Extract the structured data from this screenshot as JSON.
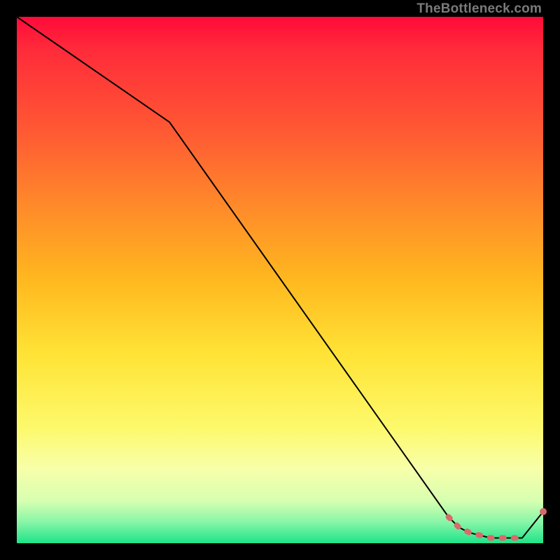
{
  "watermark": "TheBottleneck.com",
  "chart_data": {
    "type": "line",
    "title": "",
    "xlabel": "",
    "ylabel": "",
    "xlim": [
      0,
      100
    ],
    "ylim": [
      0,
      100
    ],
    "grid": false,
    "legend": false,
    "series": [
      {
        "name": "curve",
        "style": "solid-thin-black",
        "x": [
          0,
          29,
          82,
          84,
          86,
          88,
          90,
          92,
          94,
          96,
          100
        ],
        "values": [
          100,
          80,
          5,
          3,
          2,
          1.5,
          1,
          1,
          1,
          1,
          6
        ]
      },
      {
        "name": "highlight-segment",
        "style": "dashed-thick-salmon",
        "x": [
          82,
          84,
          86,
          88,
          90,
          92,
          94,
          96
        ],
        "values": [
          5,
          3,
          2,
          1.5,
          1,
          1,
          1,
          1
        ]
      }
    ],
    "points": [
      {
        "name": "end-dot",
        "x": 100,
        "y": 6,
        "color": "#d86a6a",
        "r": 5
      }
    ],
    "colors": {
      "curve": "#000000",
      "highlight": "#d86a6a",
      "gradient_top": "#ff0a3a",
      "gradient_bottom": "#1de48a"
    }
  }
}
